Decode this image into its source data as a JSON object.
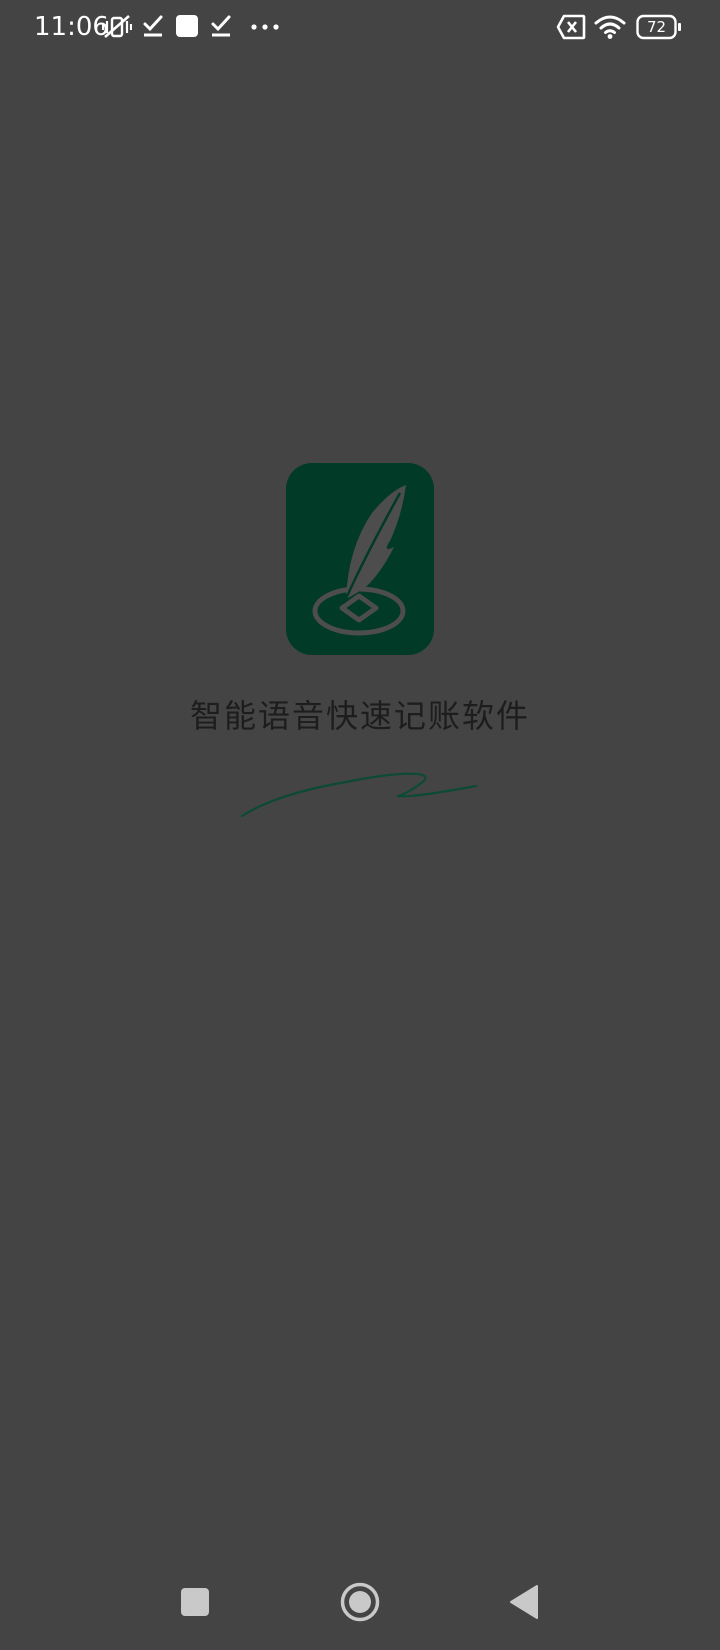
{
  "status_bar": {
    "time": "11:06",
    "battery_level": "72",
    "icons": [
      "vibrate-off-icon",
      "check-icon",
      "square-notification-icon",
      "check-icon",
      "more-dots-icon",
      "sim-off-icon",
      "wifi-icon",
      "battery-icon"
    ]
  },
  "splash": {
    "logo_icon": "feather-quill-icon",
    "logo_color": "#013a26",
    "slogan": "智能语音快速记账软件",
    "signature_color": "#0c4a33"
  },
  "nav_bar": {
    "buttons": [
      "recents-square-icon",
      "home-circle-icon",
      "back-triangle-icon"
    ]
  },
  "colors": {
    "background": "#444444",
    "status_icon": "#ffffff",
    "nav_icon": "#c9c9c9"
  }
}
